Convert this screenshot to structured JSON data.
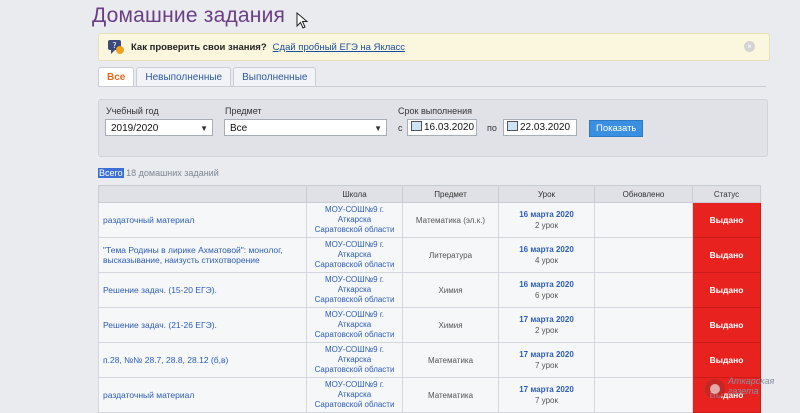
{
  "page": {
    "title": "Домашние задания"
  },
  "banner": {
    "question": "Как проверить свои знания?",
    "link": "Сдай пробный ЕГЭ на Якласс",
    "close": "×"
  },
  "tabs": [
    {
      "label": "Все",
      "active": true
    },
    {
      "label": "Невыполненные",
      "active": false
    },
    {
      "label": "Выполненные",
      "active": false
    }
  ],
  "filters": {
    "year_label": "Учебный год",
    "year_value": "2019/2020",
    "subject_label": "Предмет",
    "subject_value": "Все",
    "due_label": "Срок выполнения",
    "from_prefix": "с",
    "from_value": "16.03.2020",
    "to_prefix": "по",
    "to_value": "22.03.2020",
    "show_button": "Показать"
  },
  "total": {
    "highlight": "Всего",
    "rest": "18 домашних заданий"
  },
  "table": {
    "headers": [
      "",
      "Школа",
      "Предмет",
      "Урок",
      "Обновлено",
      "Статус"
    ],
    "rows": [
      {
        "name": "раздаточный материал",
        "school": [
          "МОУ-СОШ№9 г.",
          "Аткарска",
          "Саратовской области"
        ],
        "subject": "Математика (эл.к.)",
        "date": "16 марта 2020",
        "lesson": "2 урок",
        "updated": "",
        "status": "Выдано"
      },
      {
        "name": "\"Тема Родины в лирике Ахматовой\": монолог, высказывание, наизусть стихотворение",
        "school": [
          "МОУ-СОШ№9 г.",
          "Аткарска",
          "Саратовской области"
        ],
        "subject": "Литература",
        "date": "16 марта 2020",
        "lesson": "4 урок",
        "updated": "",
        "status": "Выдано"
      },
      {
        "name": "Решение задач. (15-20 ЕГЭ).",
        "school": [
          "МОУ-СОШ№9 г.",
          "Аткарска",
          "Саратовской области"
        ],
        "subject": "Химия",
        "date": "16 марта 2020",
        "lesson": "6 урок",
        "updated": "",
        "status": "Выдано"
      },
      {
        "name": "Решение задач. (21-26 ЕГЭ).",
        "school": [
          "МОУ-СОШ№9 г.",
          "Аткарска",
          "Саратовской области"
        ],
        "subject": "Химия",
        "date": "17 марта 2020",
        "lesson": "2 урок",
        "updated": "",
        "status": "Выдано"
      },
      {
        "name": "п.28, №№ 28.7, 28.8, 28.12 (б,в)",
        "school": [
          "МОУ-СОШ№9 г.",
          "Аткарска",
          "Саратовской области"
        ],
        "subject": "Математика",
        "date": "17 марта 2020",
        "lesson": "7 урок",
        "updated": "",
        "status": "Выдано"
      },
      {
        "name": "раздаточный материал",
        "school": [
          "МОУ-СОШ№9 г.",
          "Аткарска",
          "Саратовской области"
        ],
        "subject": "Математика",
        "date": "17 марта 2020",
        "lesson": "7 урок",
        "updated": "",
        "status": "Выдано"
      }
    ]
  },
  "watermark": {
    "line1": "Аткарская",
    "line2": "газета"
  },
  "colors": {
    "accent": "#6b3e86",
    "link": "#2d5db5",
    "status": "#e8221f",
    "button": "#3b8fe0",
    "active_tab": "#e46a1a"
  }
}
